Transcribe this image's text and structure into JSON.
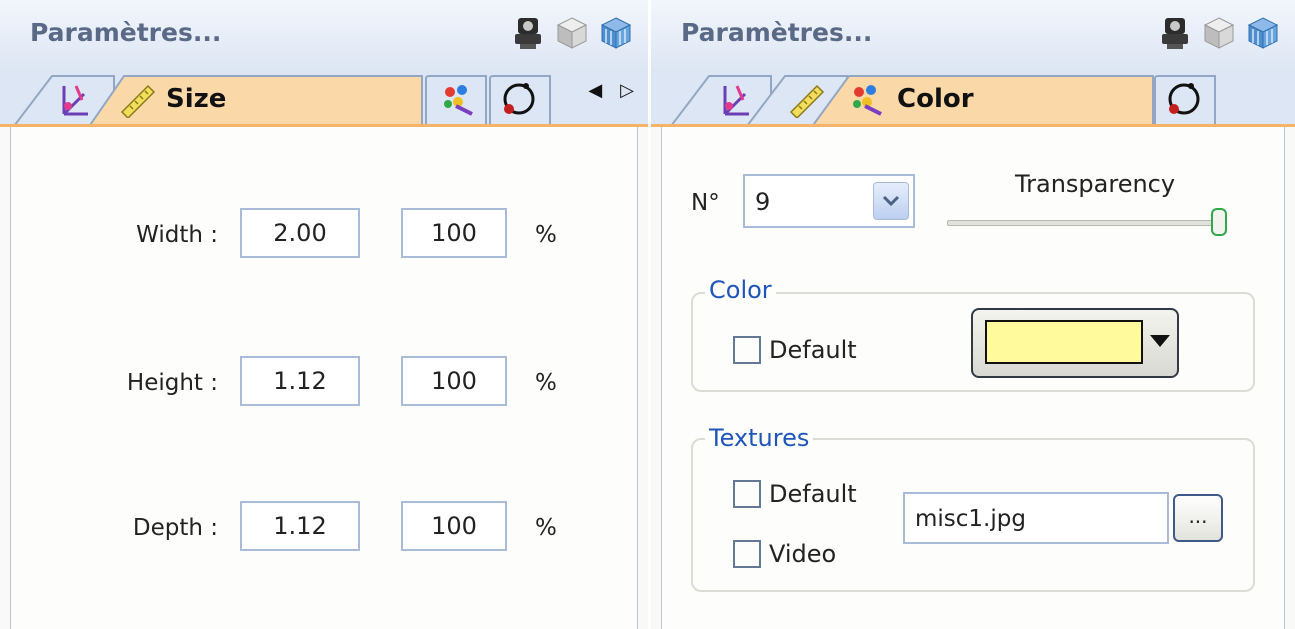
{
  "left_panel": {
    "title": "Paramètres...",
    "header_icons": [
      "projector-icon",
      "cube-icon",
      "grid-cube-icon"
    ],
    "tabs": [
      {
        "icon": "axes-icon",
        "label": ""
      },
      {
        "icon": "ruler-icon",
        "label": "Size",
        "active": true
      },
      {
        "icon": "paint-icon",
        "label": ""
      },
      {
        "icon": "rotate-icon",
        "label": ""
      }
    ],
    "arrows": {
      "left": "◀",
      "right": "▷"
    },
    "rows": [
      {
        "label": "Width :",
        "value": "2.00",
        "percent": "100",
        "unit": "%"
      },
      {
        "label": "Height :",
        "value": "1.12",
        "percent": "100",
        "unit": "%"
      },
      {
        "label": "Depth :",
        "value": "1.12",
        "percent": "100",
        "unit": "%"
      }
    ]
  },
  "right_panel": {
    "title": "Paramètres...",
    "header_icons": [
      "projector-icon",
      "cube-icon",
      "grid-cube-icon"
    ],
    "tabs": [
      {
        "icon": "axes-icon",
        "label": ""
      },
      {
        "icon": "ruler-icon",
        "label": ""
      },
      {
        "icon": "paint-icon",
        "label": "Color",
        "active": true
      },
      {
        "icon": "rotate-icon",
        "label": ""
      }
    ],
    "number": {
      "label": "N°",
      "value": "9"
    },
    "transparency": {
      "label": "Transparency",
      "level_fraction": 1.0
    },
    "color_group": {
      "title": "Color",
      "default_label": "Default",
      "default_checked": false,
      "swatch": "#fffa9c"
    },
    "textures_group": {
      "title": "Textures",
      "default_label": "Default",
      "video_label": "Video",
      "file": "misc1.jpg",
      "browse_label": "..."
    }
  }
}
